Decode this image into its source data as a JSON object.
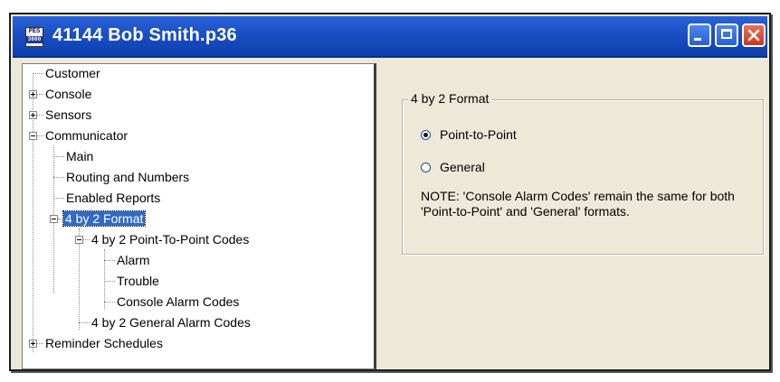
{
  "window": {
    "title": "41144 Bob Smith.p36",
    "icon_text": "PES",
    "icon_sub": "3600"
  },
  "tree": {
    "items": [
      {
        "label": "Customer",
        "expander": "none"
      },
      {
        "label": "Console",
        "expander": "plus"
      },
      {
        "label": "Sensors",
        "expander": "plus"
      },
      {
        "label": "Communicator",
        "expander": "minus"
      },
      {
        "label": "Main",
        "expander": "none"
      },
      {
        "label": "Routing and Numbers",
        "expander": "none"
      },
      {
        "label": "Enabled Reports",
        "expander": "none"
      },
      {
        "label": "4 by 2 Format",
        "expander": "minus",
        "selected": true
      },
      {
        "label": "4 by 2 Point-To-Point Codes",
        "expander": "minus"
      },
      {
        "label": "Alarm",
        "expander": "none"
      },
      {
        "label": "Trouble",
        "expander": "none"
      },
      {
        "label": "Console Alarm Codes",
        "expander": "none"
      },
      {
        "label": "4 by 2 General Alarm Codes",
        "expander": "none"
      },
      {
        "label": "Reminder Schedules",
        "expander": "plus"
      }
    ]
  },
  "panel": {
    "group_title": "4 by 2 Format",
    "options": [
      {
        "label": "Point-to-Point",
        "checked": true
      },
      {
        "label": "General",
        "checked": false
      }
    ],
    "note": "NOTE: 'Console Alarm Codes' remain the same for both 'Point-to-Point' and 'General' formats."
  },
  "colors": {
    "titlebar": "#1a4fc4",
    "selection": "#316ac5",
    "close_button": "#c8381e",
    "panel_bg": "#ece9d8"
  }
}
